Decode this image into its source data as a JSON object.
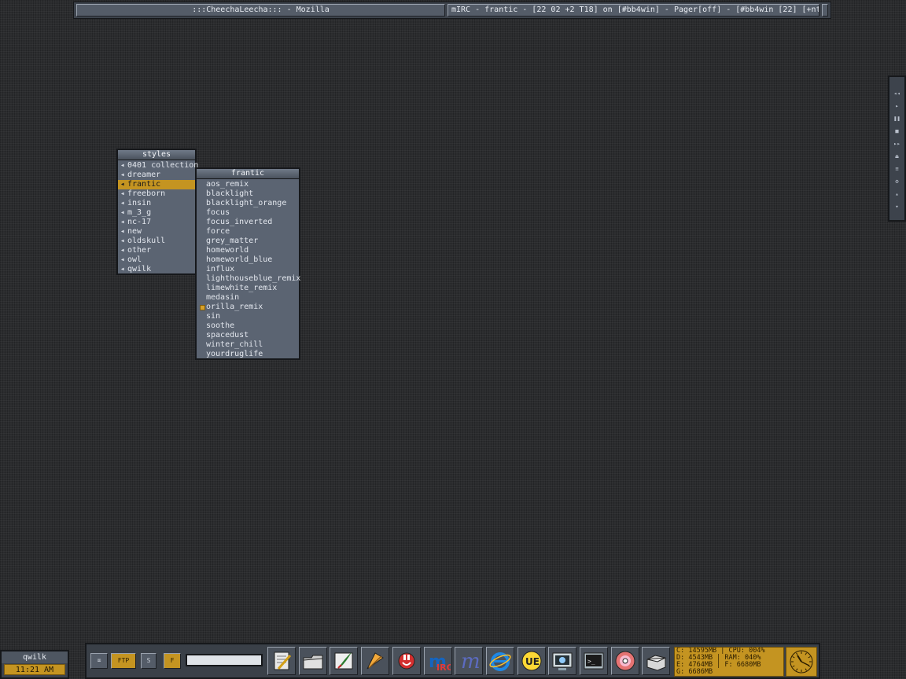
{
  "taskbar": {
    "tasks": [
      ":::CheechaLeecha::: - Mozilla",
      "mIRC - frantic - [22 02 +2 T18] on [#bb4win] - Pager[off] - [#bb4win [22] [+nt]..."
    ]
  },
  "menus": {
    "styles": {
      "title": "styles",
      "items": [
        "0401 collection",
        "dreamer",
        "frantic",
        "freeborn",
        "insin",
        "m_3_g",
        "nc-17",
        "new",
        "oldskull",
        "other",
        "owl",
        "qwilk"
      ],
      "selected": "frantic"
    },
    "frantic": {
      "title": "frantic",
      "items": [
        "aos_remix",
        "blacklight",
        "blacklight_orange",
        "focus",
        "focus_inverted",
        "force",
        "grey_matter",
        "homeworld",
        "homeworld_blue",
        "influx",
        "lighthouseblue_remix",
        "limewhite_remix",
        "medasin",
        "orilla_remix",
        "sin",
        "soothe",
        "spacedust",
        "winter_chill",
        "yourdruglife"
      ],
      "marked": "orilla_remix"
    }
  },
  "slit": {
    "controls": [
      {
        "name": "prev-icon",
        "glyph": "◂◂"
      },
      {
        "name": "play-icon",
        "glyph": "▸"
      },
      {
        "name": "pause-icon",
        "glyph": "❚❚"
      },
      {
        "name": "stop-icon",
        "glyph": "■"
      },
      {
        "name": "next-icon",
        "glyph": "▸▸"
      },
      {
        "name": "eject-icon",
        "glyph": "⏏"
      },
      {
        "name": "playlist-icon",
        "glyph": "≡"
      },
      {
        "name": "settings-icon",
        "glyph": "⚙"
      },
      {
        "name": "volume-up-icon",
        "glyph": "▴"
      },
      {
        "name": "volume-down-icon",
        "glyph": "▾"
      }
    ]
  },
  "workspace": {
    "name": "qwilk",
    "time": "11:21 AM"
  },
  "dock": {
    "buttons": {
      "cmd": "⌧",
      "ftp": "FTP",
      "s": "S",
      "f": "F"
    },
    "run_value": "",
    "launchers": [
      "notepad-icon",
      "folder-icon",
      "quill-icon",
      "feather-icon",
      "plug-icon",
      "mirc-icon",
      "m-icon",
      "ie-icon",
      "ultraedit-icon",
      "monitor-icon",
      "terminal-icon",
      "cd-icon",
      "drawer-icon"
    ],
    "stats": {
      "line1": "C: 14595MB | CPU: 004%",
      "line2": "D: 4543MB | RAM: 040%",
      "line3": "E: 4764MB | F: 6680MB",
      "line4": "G: 6686MB"
    }
  },
  "colors": {
    "accent": "#c49421",
    "panel": "#5b6472",
    "desktop": "#2b2c2e"
  }
}
